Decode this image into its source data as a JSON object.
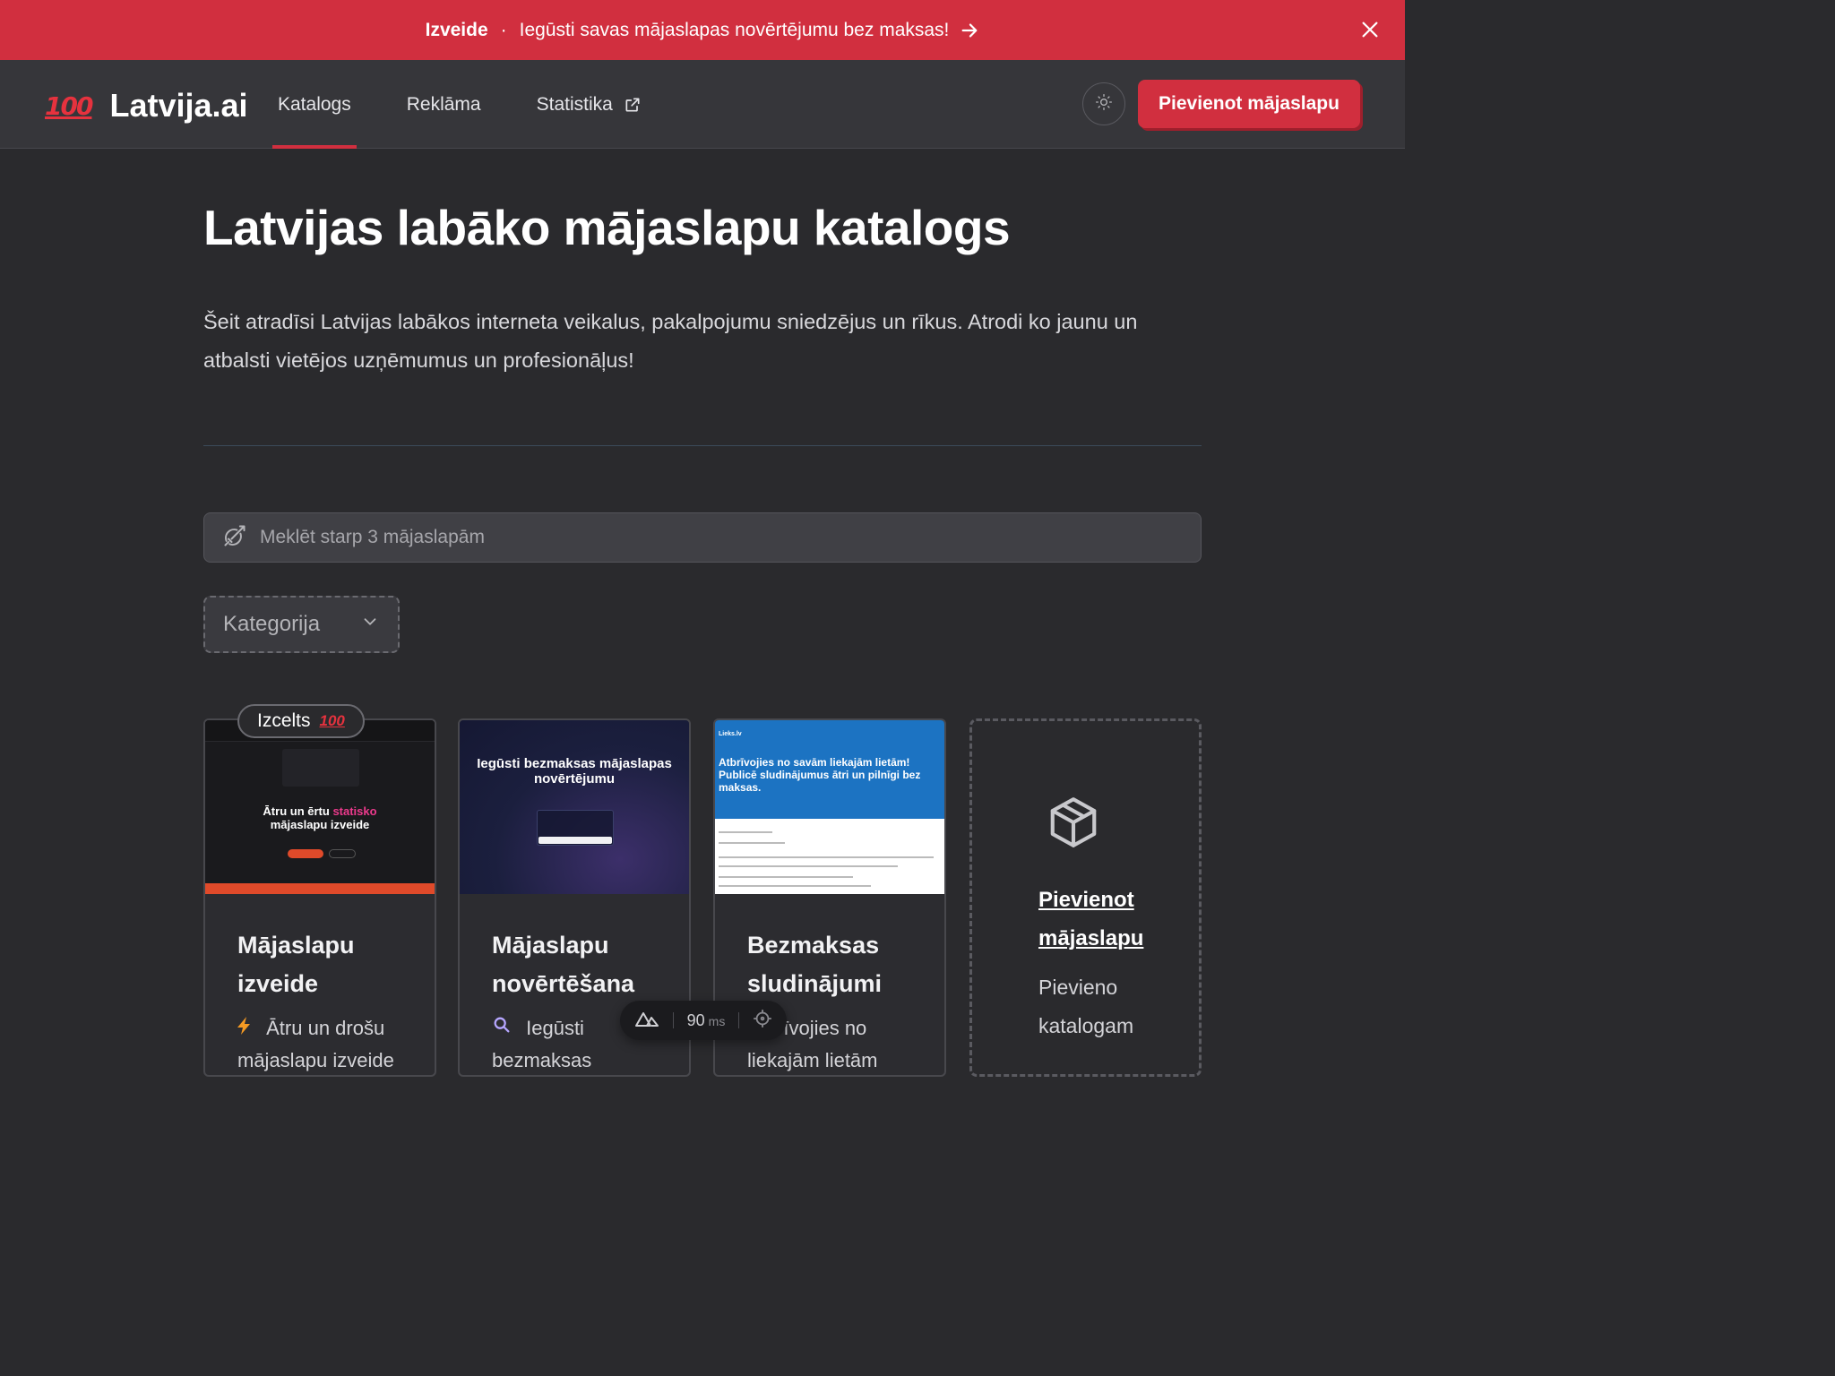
{
  "banner": {
    "brand": "Izveide",
    "separator": "·",
    "message": "Iegūsti savas mājaslapas novērtējumu bez maksas!",
    "color": "#d12f3f"
  },
  "header": {
    "logo_emoji": "100",
    "logo_text": "Latvija.ai",
    "nav": [
      {
        "label": "Katalogs",
        "active": true
      },
      {
        "label": "Reklāma",
        "active": false
      },
      {
        "label": "Statistika",
        "active": false,
        "icon": "external-link-icon"
      }
    ],
    "theme_icon": "sun-icon",
    "add_button": "Pievienot mājaslapu",
    "accent": "#d12f3f"
  },
  "main": {
    "title": "Latvijas labāko mājaslapu katalogs",
    "description": "Šeit atradīsi Latvijas labākos interneta veikalus, pakalpojumu sniedzējus un rīkus. Atrodi ko jaunu un atbalsti vietējos uzņēmumus un profesionāļus!",
    "search": {
      "placeholder": "Meklēt starp 3 mājaslapām",
      "icon": "bow-arrow-icon"
    },
    "category_filter": {
      "label": "Kategorija",
      "icon": "chevron-down-icon"
    }
  },
  "cards": [
    {
      "title": "Mājaslapu izveide",
      "desc_icon": "⚡",
      "desc": "Ātru un drošu mājaslapu izveide",
      "badge": "Izcelts",
      "badge_emoji": "100",
      "thumb": {
        "headline_a": "Ātru un ērtu",
        "headline_pink": "statisko",
        "headline_b": "mājaslapu izveide"
      }
    },
    {
      "title": "Mājaslapu novērtēšana",
      "desc_icon": "🔍",
      "desc": "Iegūsti bezmaksas",
      "thumb": {
        "headline": "Iegūsti bezmaksas mājaslapas novērtējumu"
      }
    },
    {
      "title": "Bezmaksas sludinājumi",
      "desc_icon": "",
      "desc": "Atbrīvojies no liekajām lietām",
      "thumb": {
        "brand": "Lieks.lv",
        "headline": "Atbrīvojies no savām liekajām lietām! Publicē sludinājumus ātri un pilnīgi bez maksas."
      }
    }
  ],
  "add_card": {
    "icon": "package-icon",
    "title": "Pievienot mājaslapu",
    "desc": "Pievieno katalogam"
  },
  "devtools": {
    "icon": "nuxt-icon",
    "value": "90",
    "unit": "ms",
    "target_icon": "crosshair-icon"
  }
}
